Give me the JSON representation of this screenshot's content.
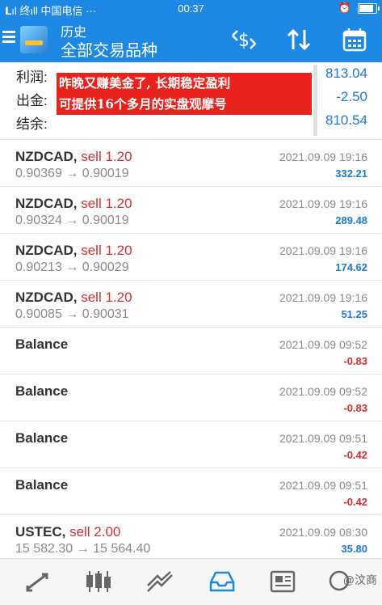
{
  "status": {
    "left": "𝗟ıl 终ıll 中国电信 ···",
    "time": "00:37",
    "right_icons": [
      "alarm-icon",
      "battery-icon"
    ]
  },
  "header": {
    "title_small": "历史",
    "title_large": "全部交易品种",
    "icons": [
      "currency-exchange-icon",
      "sort-icon",
      "calendar-icon"
    ]
  },
  "summary": [
    {
      "label": "利润:",
      "value": "813.04"
    },
    {
      "label": "出金:",
      "value": "-2.50"
    },
    {
      "label": "结余:",
      "value": "810.54"
    }
  ],
  "banner": {
    "line1": "昨晚又赚美金了, 长期稳定盈利",
    "line2": "可提供16个多月的实盘观摩号"
  },
  "rows": [
    {
      "symbol": "NZDCAD,",
      "side": " sell 1.20",
      "prices": "0.90369 → 0.90019",
      "time": "2021.09.09 19:16",
      "profit": "332.21",
      "sign": "pos"
    },
    {
      "symbol": "NZDCAD,",
      "side": " sell 1.20",
      "prices": "0.90324 → 0.90019",
      "time": "2021.09.09 19:16",
      "profit": "289.48",
      "sign": "pos"
    },
    {
      "symbol": "NZDCAD,",
      "side": " sell 1.20",
      "prices": "0.90213 → 0.90029",
      "time": "2021.09.09 19:16",
      "profit": "174.62",
      "sign": "pos"
    },
    {
      "symbol": "NZDCAD,",
      "side": " sell 1.20",
      "prices": "0.90085 → 0.90031",
      "time": "2021.09.09 19:16",
      "profit": "51.25",
      "sign": "pos"
    },
    {
      "symbol": "Balance",
      "side": "",
      "prices": "",
      "time": "2021.09.09 09:52",
      "profit": "-0.83",
      "sign": "neg"
    },
    {
      "symbol": "Balance",
      "side": "",
      "prices": "",
      "time": "2021.09.09 09:52",
      "profit": "-0.83",
      "sign": "neg"
    },
    {
      "symbol": "Balance",
      "side": "",
      "prices": "",
      "time": "2021.09.09 09:51",
      "profit": "-0.42",
      "sign": "neg"
    },
    {
      "symbol": "Balance",
      "side": "",
      "prices": "",
      "time": "2021.09.09 09:51",
      "profit": "-0.42",
      "sign": "neg"
    },
    {
      "symbol": "USTEC,",
      "side": " sell 2.00",
      "prices": "15 582.30 → 15 564.40",
      "time": "2021.09.09 08:30",
      "profit": "35.80",
      "sign": "pos"
    }
  ],
  "bottom_nav": [
    "quotes-icon",
    "chart-icon",
    "trade-icon",
    "history-icon",
    "news-icon",
    "chat-icon"
  ],
  "watermark": "@汶商",
  "colors": {
    "brand": "#1e88e5",
    "positive": "#1e78d6",
    "negative": "#d32f2f"
  }
}
